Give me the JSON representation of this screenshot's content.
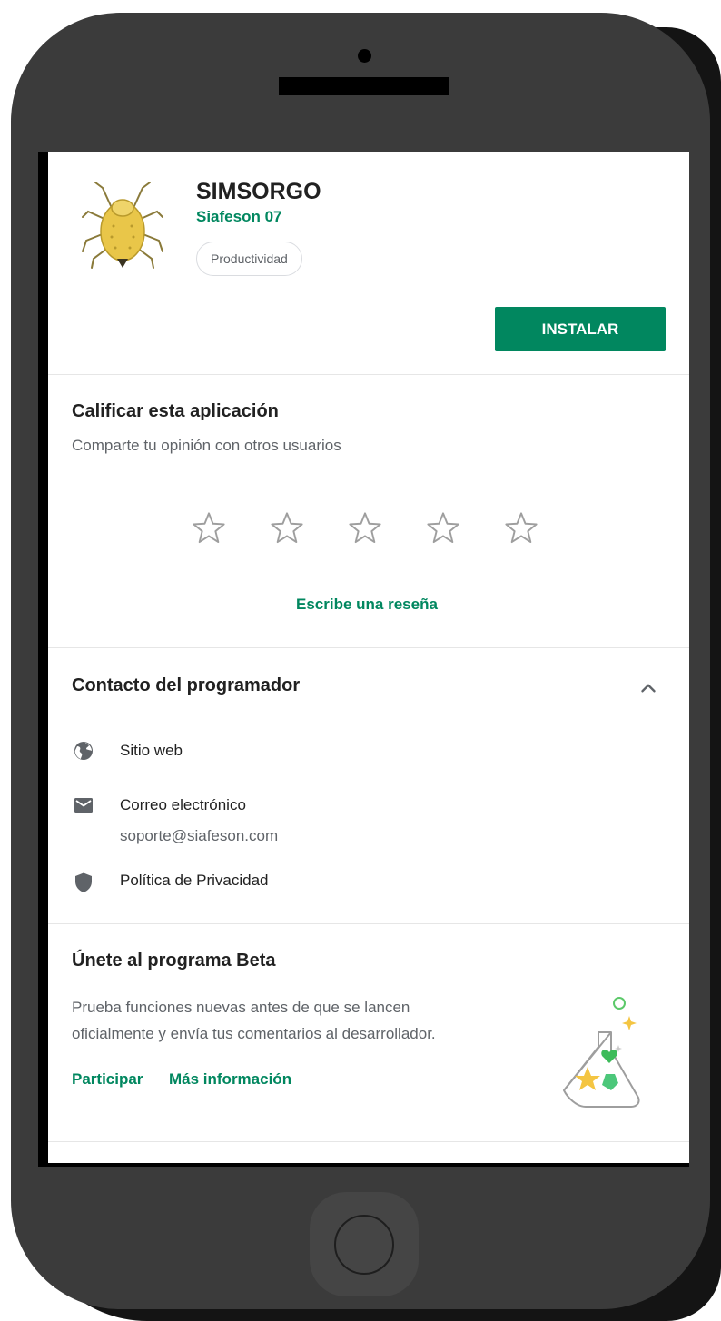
{
  "app": {
    "title": "SIMSORGO",
    "developer": "Siafeson 07",
    "category": "Productividad",
    "install_label": "INSTALAR"
  },
  "rating": {
    "title": "Calificar esta aplicación",
    "subtitle": "Comparte tu opinión con otros usuarios",
    "stars": 5,
    "review_link": "Escribe una reseña"
  },
  "contact": {
    "title": "Contacto del programador",
    "items": [
      {
        "icon": "globe-icon",
        "label": "Sitio web"
      },
      {
        "icon": "email-icon",
        "label": "Correo electrónico",
        "detail": "soporte@siafeson.com"
      },
      {
        "icon": "shield-icon",
        "label": "Política de Privacidad"
      }
    ]
  },
  "beta": {
    "title": "Únete al programa Beta",
    "description_line1": "Prueba funciones nuevas antes de que se lancen",
    "description_line2": "oficialmente y envía tus comentarios al desarrollador.",
    "join_label": "Participar",
    "more_label": "Más información"
  },
  "colors": {
    "accent": "#01875f",
    "phone_body": "#3b3b3b",
    "text_primary": "#212121",
    "text_secondary": "#5f6368"
  }
}
